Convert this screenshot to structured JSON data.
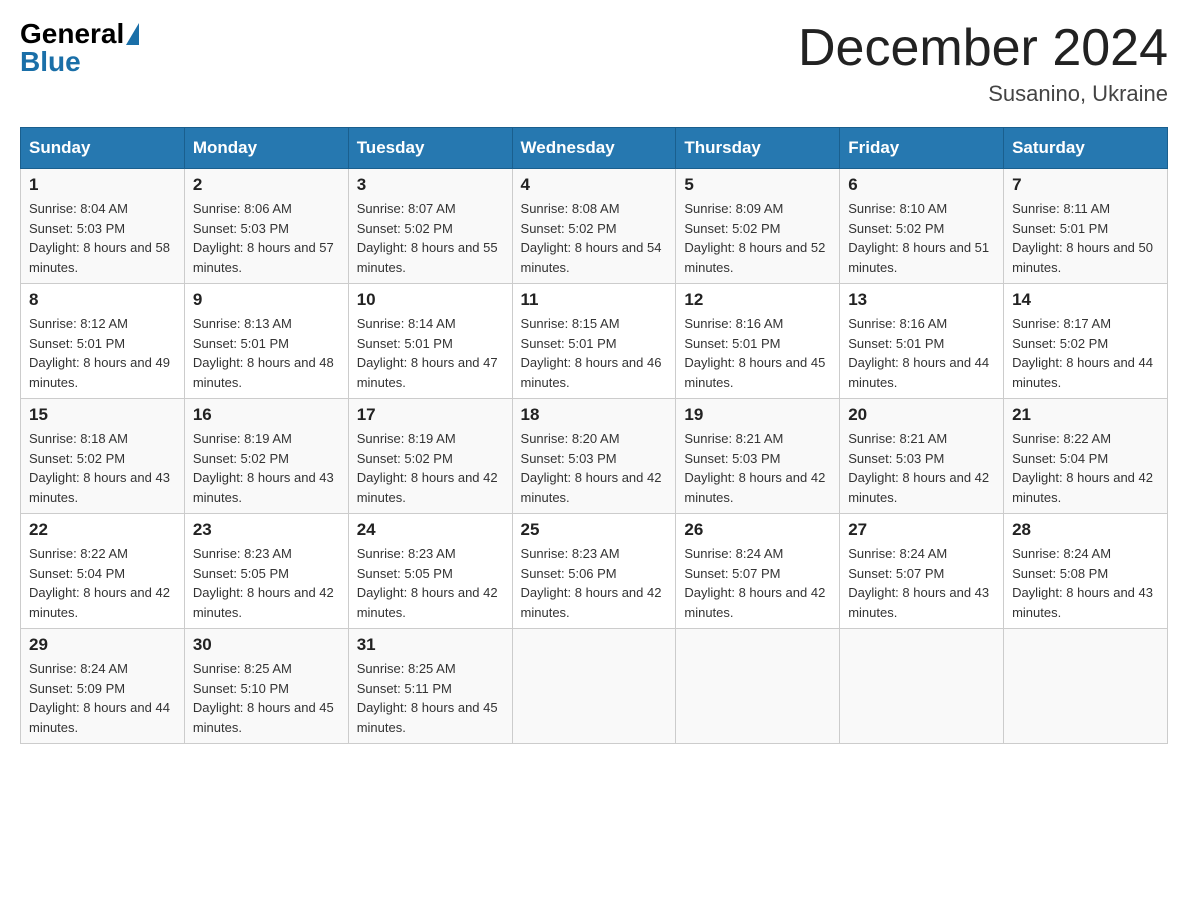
{
  "header": {
    "logo_general": "General",
    "logo_blue": "Blue",
    "month_title": "December 2024",
    "location": "Susanino, Ukraine"
  },
  "days_of_week": [
    "Sunday",
    "Monday",
    "Tuesday",
    "Wednesday",
    "Thursday",
    "Friday",
    "Saturday"
  ],
  "weeks": [
    [
      {
        "day": "1",
        "sunrise": "8:04 AM",
        "sunset": "5:03 PM",
        "daylight": "8 hours and 58 minutes."
      },
      {
        "day": "2",
        "sunrise": "8:06 AM",
        "sunset": "5:03 PM",
        "daylight": "8 hours and 57 minutes."
      },
      {
        "day": "3",
        "sunrise": "8:07 AM",
        "sunset": "5:02 PM",
        "daylight": "8 hours and 55 minutes."
      },
      {
        "day": "4",
        "sunrise": "8:08 AM",
        "sunset": "5:02 PM",
        "daylight": "8 hours and 54 minutes."
      },
      {
        "day": "5",
        "sunrise": "8:09 AM",
        "sunset": "5:02 PM",
        "daylight": "8 hours and 52 minutes."
      },
      {
        "day": "6",
        "sunrise": "8:10 AM",
        "sunset": "5:02 PM",
        "daylight": "8 hours and 51 minutes."
      },
      {
        "day": "7",
        "sunrise": "8:11 AM",
        "sunset": "5:01 PM",
        "daylight": "8 hours and 50 minutes."
      }
    ],
    [
      {
        "day": "8",
        "sunrise": "8:12 AM",
        "sunset": "5:01 PM",
        "daylight": "8 hours and 49 minutes."
      },
      {
        "day": "9",
        "sunrise": "8:13 AM",
        "sunset": "5:01 PM",
        "daylight": "8 hours and 48 minutes."
      },
      {
        "day": "10",
        "sunrise": "8:14 AM",
        "sunset": "5:01 PM",
        "daylight": "8 hours and 47 minutes."
      },
      {
        "day": "11",
        "sunrise": "8:15 AM",
        "sunset": "5:01 PM",
        "daylight": "8 hours and 46 minutes."
      },
      {
        "day": "12",
        "sunrise": "8:16 AM",
        "sunset": "5:01 PM",
        "daylight": "8 hours and 45 minutes."
      },
      {
        "day": "13",
        "sunrise": "8:16 AM",
        "sunset": "5:01 PM",
        "daylight": "8 hours and 44 minutes."
      },
      {
        "day": "14",
        "sunrise": "8:17 AM",
        "sunset": "5:02 PM",
        "daylight": "8 hours and 44 minutes."
      }
    ],
    [
      {
        "day": "15",
        "sunrise": "8:18 AM",
        "sunset": "5:02 PM",
        "daylight": "8 hours and 43 minutes."
      },
      {
        "day": "16",
        "sunrise": "8:19 AM",
        "sunset": "5:02 PM",
        "daylight": "8 hours and 43 minutes."
      },
      {
        "day": "17",
        "sunrise": "8:19 AM",
        "sunset": "5:02 PM",
        "daylight": "8 hours and 42 minutes."
      },
      {
        "day": "18",
        "sunrise": "8:20 AM",
        "sunset": "5:03 PM",
        "daylight": "8 hours and 42 minutes."
      },
      {
        "day": "19",
        "sunrise": "8:21 AM",
        "sunset": "5:03 PM",
        "daylight": "8 hours and 42 minutes."
      },
      {
        "day": "20",
        "sunrise": "8:21 AM",
        "sunset": "5:03 PM",
        "daylight": "8 hours and 42 minutes."
      },
      {
        "day": "21",
        "sunrise": "8:22 AM",
        "sunset": "5:04 PM",
        "daylight": "8 hours and 42 minutes."
      }
    ],
    [
      {
        "day": "22",
        "sunrise": "8:22 AM",
        "sunset": "5:04 PM",
        "daylight": "8 hours and 42 minutes."
      },
      {
        "day": "23",
        "sunrise": "8:23 AM",
        "sunset": "5:05 PM",
        "daylight": "8 hours and 42 minutes."
      },
      {
        "day": "24",
        "sunrise": "8:23 AM",
        "sunset": "5:05 PM",
        "daylight": "8 hours and 42 minutes."
      },
      {
        "day": "25",
        "sunrise": "8:23 AM",
        "sunset": "5:06 PM",
        "daylight": "8 hours and 42 minutes."
      },
      {
        "day": "26",
        "sunrise": "8:24 AM",
        "sunset": "5:07 PM",
        "daylight": "8 hours and 42 minutes."
      },
      {
        "day": "27",
        "sunrise": "8:24 AM",
        "sunset": "5:07 PM",
        "daylight": "8 hours and 43 minutes."
      },
      {
        "day": "28",
        "sunrise": "8:24 AM",
        "sunset": "5:08 PM",
        "daylight": "8 hours and 43 minutes."
      }
    ],
    [
      {
        "day": "29",
        "sunrise": "8:24 AM",
        "sunset": "5:09 PM",
        "daylight": "8 hours and 44 minutes."
      },
      {
        "day": "30",
        "sunrise": "8:25 AM",
        "sunset": "5:10 PM",
        "daylight": "8 hours and 45 minutes."
      },
      {
        "day": "31",
        "sunrise": "8:25 AM",
        "sunset": "5:11 PM",
        "daylight": "8 hours and 45 minutes."
      },
      null,
      null,
      null,
      null
    ]
  ]
}
